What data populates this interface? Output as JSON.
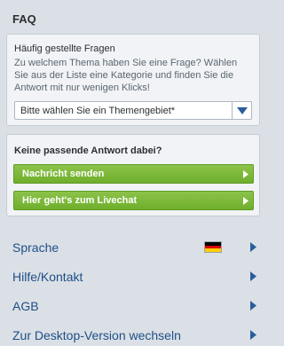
{
  "header": {
    "title": "FAQ"
  },
  "faq_card": {
    "title": "Häufig gestellte Fragen",
    "text": "Zu welchem Thema haben Sie eine Frage? Wählen Sie aus der Liste eine Kategorie und finden Sie die Antwort mit nur wenigen Klicks!",
    "select_value": "Bitte wählen Sie ein Themengebiet*"
  },
  "contact_card": {
    "title": "Keine passende Antwort dabei?",
    "message_button": "Nachricht senden",
    "chat_button": "Hier geht's zum Livechat"
  },
  "menu": {
    "items": [
      {
        "label": "Sprache",
        "flag": "de-flag-icon"
      },
      {
        "label": "Hilfe/Kontakt"
      },
      {
        "label": "AGB"
      },
      {
        "label": "Zur Desktop-Version wechseln"
      }
    ]
  },
  "colors": {
    "background": "#dbe0e6",
    "card": "#f1f3f6",
    "button_green": "#7cb83a",
    "link_blue": "#1d4f86",
    "arrow_blue": "#2a5d9a"
  }
}
